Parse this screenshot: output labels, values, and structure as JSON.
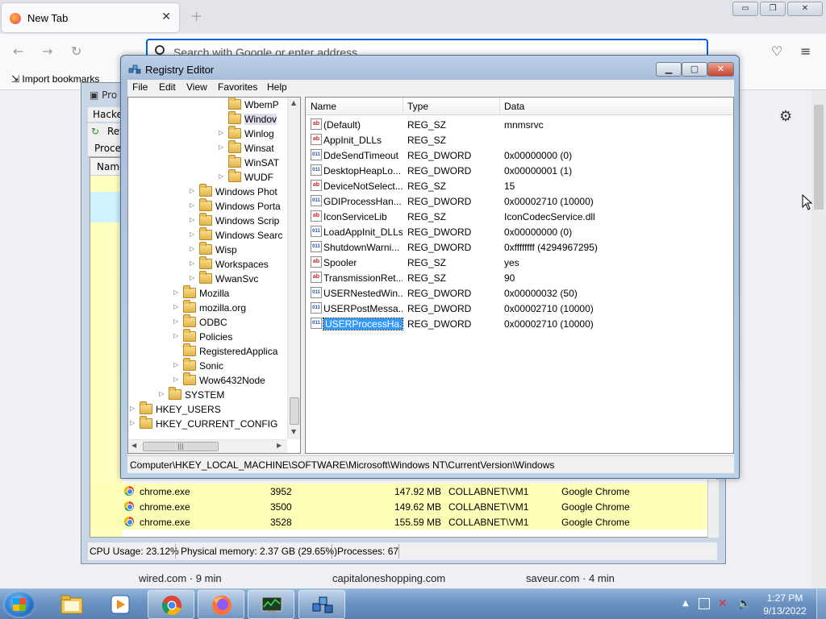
{
  "firefox": {
    "tab_title": "New Tab",
    "url_placeholder": "Search with Google or enter address",
    "import_bookmarks": "Import bookmarks",
    "tiles": [
      "wired.com · 9 min",
      "capitaloneshopping.com",
      "saveur.com · 4 min"
    ]
  },
  "process_hacker": {
    "title": "Pro",
    "menu": "Hacke",
    "toolbar_refresh": "Ref",
    "tab": "Proces",
    "col_name": "Name",
    "rows": [
      {
        "name": "chrome.exe",
        "pid": "3952",
        "memory": "147.92 MB",
        "user": "COLLABNET\\VM1",
        "description": "Google Chrome"
      },
      {
        "name": "chrome.exe",
        "pid": "3500",
        "memory": "149.62 MB",
        "user": "COLLABNET\\VM1",
        "description": "Google Chrome"
      },
      {
        "name": "chrome.exe",
        "pid": "3528",
        "memory": "155.59 MB",
        "user": "COLLABNET\\VM1",
        "description": "Google Chrome"
      }
    ],
    "status": {
      "cpu": "CPU Usage: 23.12%",
      "memory": "Physical memory: 2.37 GB (29.65%)",
      "processes": "Processes: 67"
    }
  },
  "regedit": {
    "title": "Registry Editor",
    "menu": [
      "File",
      "Edit",
      "View",
      "Favorites",
      "Help"
    ],
    "tree": [
      {
        "label": "WbemP",
        "level": 7
      },
      {
        "label": "Windov",
        "level": 7,
        "selected": true
      },
      {
        "label": "Winlog",
        "level": 7,
        "expander": true
      },
      {
        "label": "Winsat",
        "level": 7,
        "expander": true
      },
      {
        "label": "WinSAT",
        "level": 7
      },
      {
        "label": "WUDF",
        "level": 7,
        "expander": true
      },
      {
        "label": "Windows Phot",
        "level": 6,
        "expander": true
      },
      {
        "label": "Windows Porta",
        "level": 6,
        "expander": true
      },
      {
        "label": "Windows Scrip",
        "level": 6,
        "expander": true
      },
      {
        "label": "Windows Searc",
        "level": 6,
        "expander": true
      },
      {
        "label": "Wisp",
        "level": 6,
        "expander": true
      },
      {
        "label": "Workspaces",
        "level": 6,
        "expander": true
      },
      {
        "label": "WwanSvc",
        "level": 6,
        "expander": true
      },
      {
        "label": "Mozilla",
        "level": 5,
        "expander": true
      },
      {
        "label": "mozilla.org",
        "level": 5,
        "expander": true
      },
      {
        "label": "ODBC",
        "level": 5,
        "expander": true
      },
      {
        "label": "Policies",
        "level": 5,
        "expander": true
      },
      {
        "label": "RegisteredApplica",
        "level": 5
      },
      {
        "label": "Sonic",
        "level": 5,
        "expander": true
      },
      {
        "label": "Wow6432Node",
        "level": 5,
        "expander": true
      },
      {
        "label": "SYSTEM",
        "level": 4,
        "expander": true
      },
      {
        "label": "HKEY_USERS",
        "level": 3,
        "expander": true
      },
      {
        "label": "HKEY_CURRENT_CONFIG",
        "level": 3,
        "expander": true
      }
    ],
    "columns": {
      "name": "Name",
      "type": "Type",
      "data": "Data"
    },
    "values": [
      {
        "kind": "sz",
        "name": "(Default)",
        "type": "REG_SZ",
        "data": "mnmsrvc"
      },
      {
        "kind": "sz",
        "name": "AppInit_DLLs",
        "type": "REG_SZ",
        "data": ""
      },
      {
        "kind": "dword",
        "name": "DdeSendTimeout",
        "type": "REG_DWORD",
        "data": "0x00000000 (0)"
      },
      {
        "kind": "dword",
        "name": "DesktopHeapLo...",
        "type": "REG_DWORD",
        "data": "0x00000001 (1)"
      },
      {
        "kind": "sz",
        "name": "DeviceNotSelect...",
        "type": "REG_SZ",
        "data": "15"
      },
      {
        "kind": "dword",
        "name": "GDIProcessHan...",
        "type": "REG_DWORD",
        "data": "0x00002710 (10000)"
      },
      {
        "kind": "sz",
        "name": "IconServiceLib",
        "type": "REG_SZ",
        "data": "IconCodecService.dll"
      },
      {
        "kind": "dword",
        "name": "LoadAppInit_DLLs",
        "type": "REG_DWORD",
        "data": "0x00000000 (0)"
      },
      {
        "kind": "dword",
        "name": "ShutdownWarni...",
        "type": "REG_DWORD",
        "data": "0xffffffff (4294967295)"
      },
      {
        "kind": "sz",
        "name": "Spooler",
        "type": "REG_SZ",
        "data": "yes"
      },
      {
        "kind": "sz",
        "name": "TransmissionRet...",
        "type": "REG_SZ",
        "data": "90"
      },
      {
        "kind": "dword",
        "name": "USERNestedWin...",
        "type": "REG_DWORD",
        "data": "0x00000032 (50)"
      },
      {
        "kind": "dword",
        "name": "USERPostMessa...",
        "type": "REG_DWORD",
        "data": "0x00002710 (10000)"
      },
      {
        "kind": "dword",
        "name": "USERProcessHa...",
        "type": "REG_DWORD",
        "data": "0x00002710 (10000)",
        "selected": true
      }
    ],
    "status_path": "Computer\\HKEY_LOCAL_MACHINE\\SOFTWARE\\Microsoft\\Windows NT\\CurrentVersion\\Windows"
  },
  "taskbar": {
    "clock_time": "1:27 PM",
    "clock_date": "9/13/2022",
    "apps": [
      "explorer",
      "media-player",
      "chrome",
      "firefox",
      "process-hacker",
      "regedit"
    ]
  }
}
